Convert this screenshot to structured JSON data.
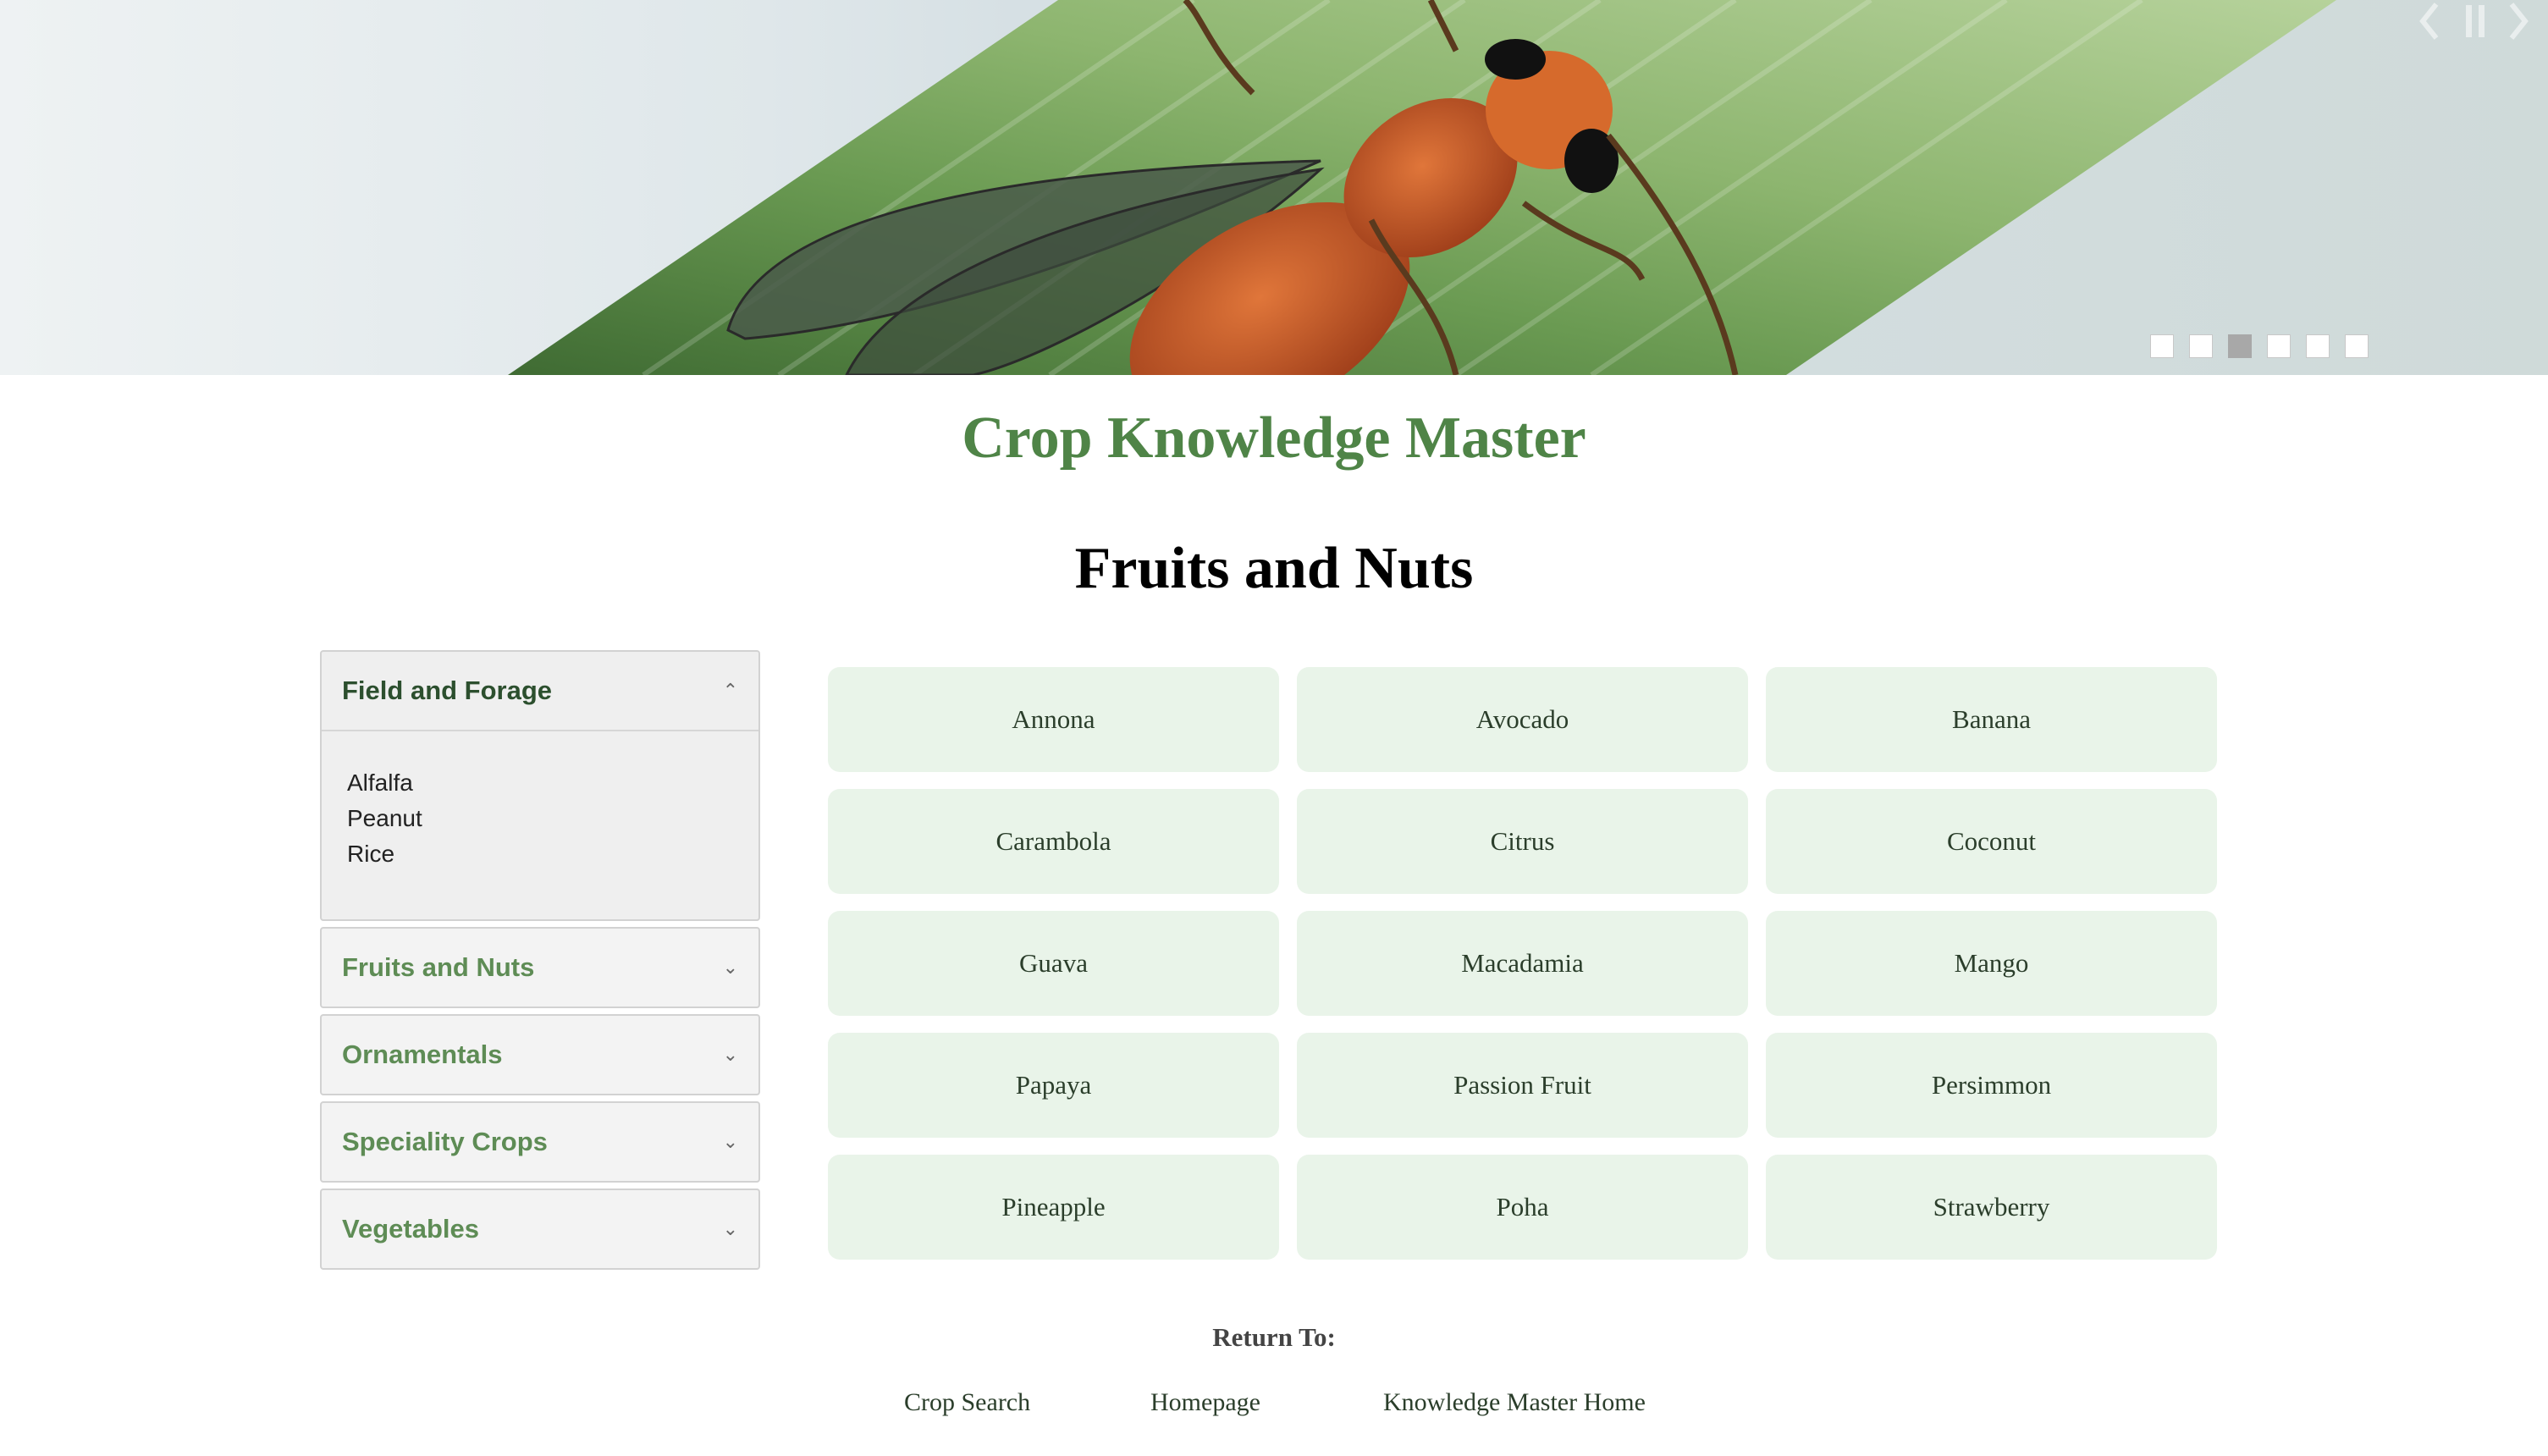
{
  "hero": {
    "slides": [
      {
        "active": false
      },
      {
        "active": false
      },
      {
        "active": true
      },
      {
        "active": false
      },
      {
        "active": false
      },
      {
        "active": false
      }
    ],
    "controls": {
      "prev_icon": "chevron-left-icon",
      "pause_icon": "pause-icon",
      "next_icon": "chevron-right-icon"
    }
  },
  "site_title": "Crop Knowledge Master",
  "page_heading": "Fruits and Nuts",
  "sidebar": {
    "open_section": {
      "title": "Field and Forage",
      "icon": "chevron-up-icon",
      "items": [
        "Alfalfa",
        "Peanut",
        "Rice"
      ]
    },
    "sections": [
      {
        "title": "Fruits and Nuts",
        "icon": "chevron-down-icon"
      },
      {
        "title": "Ornamentals",
        "icon": "chevron-down-icon"
      },
      {
        "title": "Speciality Crops",
        "icon": "chevron-down-icon"
      },
      {
        "title": "Vegetables",
        "icon": "chevron-down-icon"
      }
    ]
  },
  "crops": [
    "Annona",
    "Avocado",
    "Banana",
    "Carambola",
    "Citrus",
    "Coconut",
    "Guava",
    "Macadamia",
    "Mango",
    "Papaya",
    "Passion Fruit",
    "Persimmon",
    "Pineapple",
    "Poha",
    "Strawberry"
  ],
  "footer": {
    "return_label": "Return To:",
    "links": [
      "Crop Search",
      "Homepage",
      "Knowledge Master Home"
    ]
  },
  "colors": {
    "brand_green": "#4f8447",
    "tile_bg": "#e9f4e9",
    "sidebar_label": "#5e8c55"
  }
}
